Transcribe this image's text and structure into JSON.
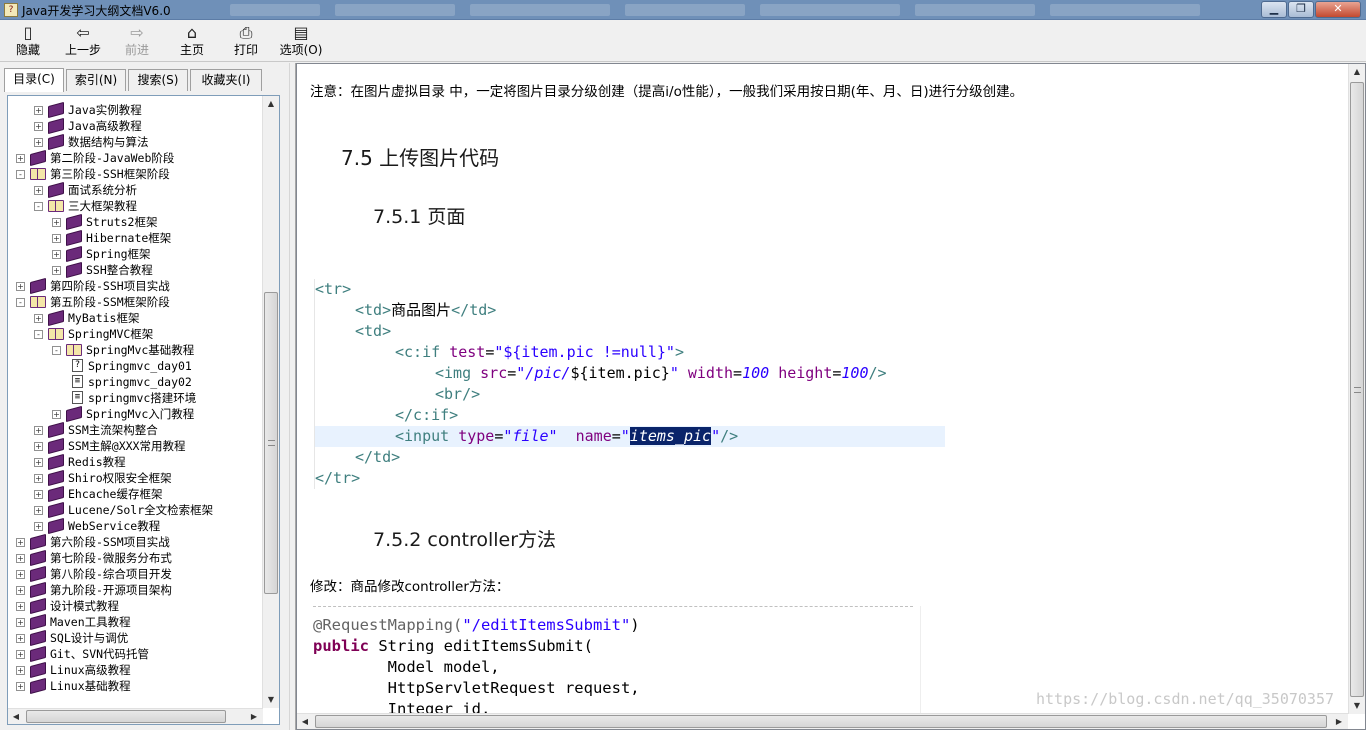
{
  "window": {
    "title": "Java开发学习大纲文档V6.0",
    "app_icon": "?",
    "buttons": [
      "▁",
      "❐",
      "✕"
    ]
  },
  "toolbar": [
    {
      "name": "hide",
      "label": "隐藏",
      "icon": "▯"
    },
    {
      "name": "back",
      "label": "上一步",
      "icon": "⇦"
    },
    {
      "name": "forward",
      "label": "前进",
      "icon": "⇨",
      "disabled": true
    },
    {
      "name": "home",
      "label": "主页",
      "icon": "⌂"
    },
    {
      "name": "print",
      "label": "打印",
      "icon": "⎙"
    },
    {
      "name": "options",
      "label": "选项(O)",
      "icon": "▤"
    }
  ],
  "tabs": [
    "目录(C)",
    "索引(N)",
    "搜索(S)",
    "收藏夹(I)"
  ],
  "tree": [
    {
      "label": "Java实例教程",
      "depth": 1,
      "icon": "book",
      "state": "+"
    },
    {
      "label": "Java高级教程",
      "depth": 1,
      "icon": "book",
      "state": "+"
    },
    {
      "label": "数据结构与算法",
      "depth": 1,
      "icon": "book",
      "state": "+"
    },
    {
      "label": "第二阶段-JavaWeb阶段",
      "depth": 0,
      "icon": "book",
      "state": "+"
    },
    {
      "label": "第三阶段-SSH框架阶段",
      "depth": 0,
      "icon": "open",
      "state": "-"
    },
    {
      "label": "面试系统分析",
      "depth": 1,
      "icon": "book",
      "state": "+"
    },
    {
      "label": "三大框架教程",
      "depth": 1,
      "icon": "open",
      "state": "-"
    },
    {
      "label": "Struts2框架",
      "depth": 2,
      "icon": "book",
      "state": "+"
    },
    {
      "label": "Hibernate框架",
      "depth": 2,
      "icon": "book",
      "state": "+"
    },
    {
      "label": "Spring框架",
      "depth": 2,
      "icon": "book",
      "state": "+"
    },
    {
      "label": "SSH整合教程",
      "depth": 2,
      "icon": "book",
      "state": "+"
    },
    {
      "label": "第四阶段-SSH项目实战",
      "depth": 0,
      "icon": "book",
      "state": "+"
    },
    {
      "label": "第五阶段-SSM框架阶段",
      "depth": 0,
      "icon": "open",
      "state": "-"
    },
    {
      "label": "MyBatis框架",
      "depth": 1,
      "icon": "book",
      "state": "+"
    },
    {
      "label": "SpringMVC框架",
      "depth": 1,
      "icon": "open",
      "state": "-"
    },
    {
      "label": "SpringMvc基础教程",
      "depth": 2,
      "icon": "open",
      "state": "-"
    },
    {
      "label": "Springmvc_day01",
      "depth": 3,
      "icon": "page-q",
      "state": ""
    },
    {
      "label": "springmvc_day02",
      "depth": 3,
      "icon": "page",
      "state": ""
    },
    {
      "label": "springmvc搭建环境",
      "depth": 3,
      "icon": "page",
      "state": ""
    },
    {
      "label": "SpringMvc入门教程",
      "depth": 2,
      "icon": "book",
      "state": "+"
    },
    {
      "label": "SSM主流架构整合",
      "depth": 1,
      "icon": "book",
      "state": "+"
    },
    {
      "label": "SSM主解@XXX常用教程",
      "depth": 1,
      "icon": "book",
      "state": "+"
    },
    {
      "label": "Redis教程",
      "depth": 1,
      "icon": "book",
      "state": "+"
    },
    {
      "label": "Shiro权限安全框架",
      "depth": 1,
      "icon": "book",
      "state": "+"
    },
    {
      "label": "Ehcache缓存框架",
      "depth": 1,
      "icon": "book",
      "state": "+"
    },
    {
      "label": "Lucene/Solr全文检索框架",
      "depth": 1,
      "icon": "book",
      "state": "+"
    },
    {
      "label": "WebService教程",
      "depth": 1,
      "icon": "book",
      "state": "+"
    },
    {
      "label": "第六阶段-SSM项目实战",
      "depth": 0,
      "icon": "book",
      "state": "+"
    },
    {
      "label": "第七阶段-微服务分布式",
      "depth": 0,
      "icon": "book",
      "state": "+"
    },
    {
      "label": "第八阶段-综合项目开发",
      "depth": 0,
      "icon": "book",
      "state": "+"
    },
    {
      "label": "第九阶段-开源项目架构",
      "depth": 0,
      "icon": "book",
      "state": "+"
    },
    {
      "label": "设计模式教程",
      "depth": 0,
      "icon": "book",
      "state": "+"
    },
    {
      "label": "Maven工具教程",
      "depth": 0,
      "icon": "book",
      "state": "+"
    },
    {
      "label": "SQL设计与调优",
      "depth": 0,
      "icon": "book",
      "state": "+"
    },
    {
      "label": "Git、SVN代码托管",
      "depth": 0,
      "icon": "book",
      "state": "+"
    },
    {
      "label": "Linux高级教程",
      "depth": 0,
      "icon": "book",
      "state": "+"
    },
    {
      "label": "Linux基础教程",
      "depth": 0,
      "icon": "book",
      "state": "+"
    }
  ],
  "content": {
    "note": "注意：在图片虚拟目录 中，一定将图片目录分级创建（提高i/o性能），一般我们采用按日期(年、月、日)进行分级创建。",
    "h2": "7.5  上传图片代码",
    "h3a": "7.5.1  页面",
    "code": {
      "l1": "<tr>",
      "l2_open": "<td>",
      "l2_text": "商品图片",
      "l2_close": "</td>",
      "l3": "<td>",
      "l4_tag": "<c:if",
      "l4_attr": "test",
      "l4_eq": "=",
      "l4_val": "\"${item.pic !=null}\"",
      "l4_end": ">",
      "l5_tag": "<img",
      "l5_a1": "src",
      "l5_v1a": "\"/pic/",
      "l5_v1b": "${item.pic}",
      "l5_v1c": "\"",
      "l5_a2": "width",
      "l5_v2": "100",
      "l5_a3": "height",
      "l5_v3": "100",
      "l5_end": "/>",
      "l6": "<br/>",
      "l7": "</c:if>",
      "l8_tag": "<input",
      "l8_a1": "type",
      "l8_v1": "\"file\"",
      "l8_a2": "name",
      "l8_q": "\"",
      "l8_sel": "items_pic",
      "l8_q2": "\"",
      "l8_end": "/>",
      "l9": "</td>",
      "l10": "</tr>"
    },
    "h3b": "7.5.2  controller方法",
    "modify": "修改：商品修改controller方法：",
    "java": {
      "j1": "@RequestMapping(",
      "j1s": "\"/editItemsSubmit\"",
      "j1e": ")",
      "j2k": "public",
      "j2": " String editItemsSubmit(",
      "j3": "        Model model,",
      "j4": "        HttpServletRequest request,",
      "j5": "        Integer id,"
    },
    "watermark": "https://blog.csdn.net/qq_35070357"
  },
  "colors": {
    "title_bar": "#6f90b8",
    "tag": "#3f7f7f",
    "attr": "#7f007f",
    "string": "#2a00ff",
    "keyword": "#7f0055",
    "book": "#6b2a7a"
  }
}
